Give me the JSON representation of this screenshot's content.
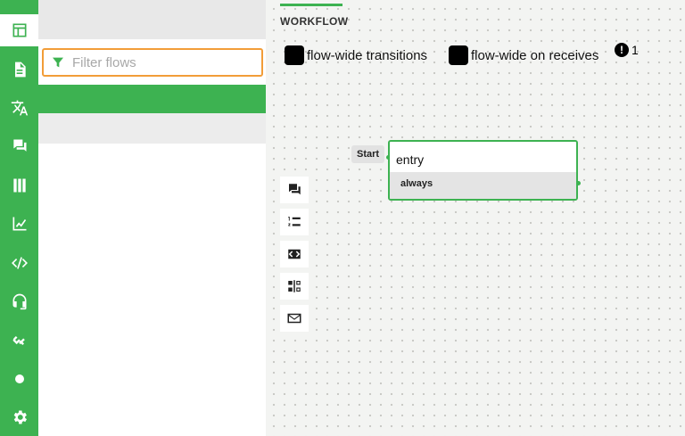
{
  "sidebar": {
    "items": [
      {
        "name": "layout-icon",
        "active": true
      },
      {
        "name": "document-icon",
        "active": false
      },
      {
        "name": "translate-icon",
        "active": false
      },
      {
        "name": "chat-icon",
        "active": false
      },
      {
        "name": "library-icon",
        "active": false
      },
      {
        "name": "chart-icon",
        "active": false
      },
      {
        "name": "code-icon",
        "active": false
      },
      {
        "name": "headset-icon",
        "active": false
      },
      {
        "name": "link-icon",
        "active": false
      },
      {
        "name": "dot-icon",
        "active": false
      },
      {
        "name": "gear-icon",
        "active": false
      }
    ]
  },
  "flows": {
    "filter_placeholder": "Filter flows",
    "filter_value": ""
  },
  "workflow": {
    "tab_label": "WORKFLOW",
    "options": [
      "flow-wide transitions",
      "flow-wide on receives"
    ],
    "warning_symbol": "!",
    "warning_count": "1",
    "start_label": "Start",
    "node": {
      "title": "entry",
      "exit": "always"
    },
    "tools": [
      "chat-icon",
      "numbered-list-icon",
      "code-block-icon",
      "split-icon",
      "mail-icon"
    ]
  },
  "colors": {
    "accent": "#3db251",
    "focus_border": "#f29d38",
    "canvas_bg": "#f3f4f2"
  }
}
